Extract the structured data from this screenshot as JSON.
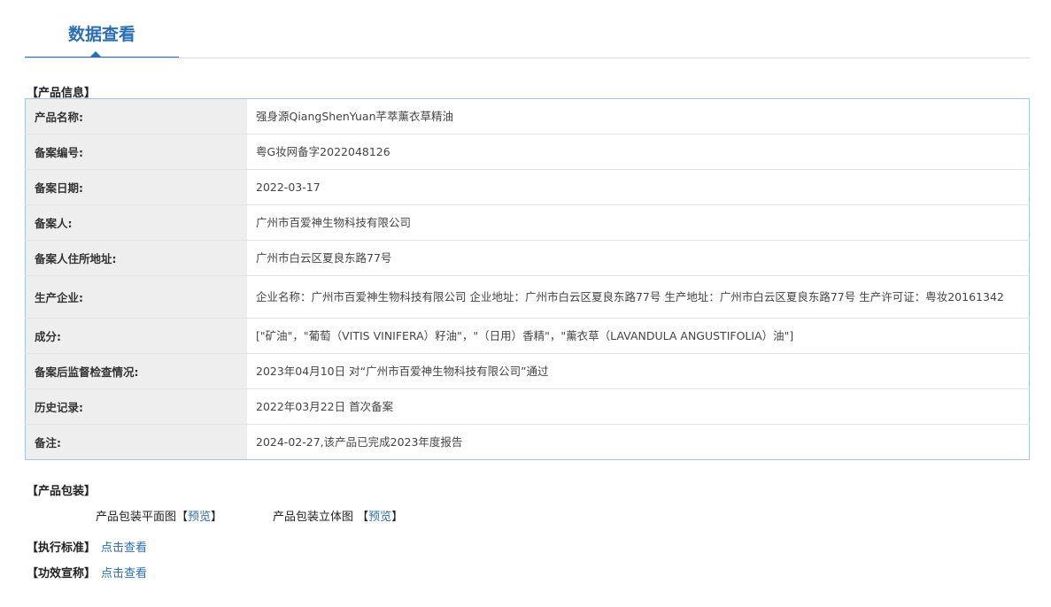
{
  "tab": {
    "title": "数据查看"
  },
  "sections": {
    "product_info": "【产品信息】",
    "packaging": "【产品包装】"
  },
  "rows": [
    {
      "label": "产品名称:",
      "value": "强身源QiangShenYuan芊萃薰衣草精油"
    },
    {
      "label": "备案编号:",
      "value": "粤G妆网备字2022048126"
    },
    {
      "label": "备案日期:",
      "value": "2022-03-17"
    },
    {
      "label": "备案人:",
      "value": "广州市百爱神生物科技有限公司"
    },
    {
      "label": "备案人住所地址:",
      "value": "广州市白云区夏良东路77号"
    },
    {
      "label": "生产企业:",
      "value": "企业名称：广州市百爱神生物科技有限公司 企业地址：广州市白云区夏良东路77号 生产地址：广州市白云区夏良东路77号 生产许可证：粤妆20161342"
    },
    {
      "label": "成分:",
      "value": "[\"矿油\"，\"葡萄（VITIS VINIFERA）籽油\"，\"（日用）香精\"，\"薰衣草（LAVANDULA ANGUSTIFOLIA）油\"]"
    },
    {
      "label": "备案后监督检查情况:",
      "value": "2023年04月10日 对“广州市百爱神生物科技有限公司”通过"
    },
    {
      "label": "历史记录:",
      "value": "2022年03月22日 首次备案"
    },
    {
      "label": "备注:",
      "value": "2024-02-27,该产品已完成2023年度报告"
    }
  ],
  "packaging": {
    "flat_label": "产品包装平面图",
    "solid_label": "产品包装立体图",
    "bracket_open": "【",
    "bracket_close": "】",
    "preview_link": "预览"
  },
  "standard": {
    "label": "【执行标准】",
    "link": "点击查看"
  },
  "efficacy": {
    "label": "【功效宣称】",
    "link": "点击查看"
  }
}
